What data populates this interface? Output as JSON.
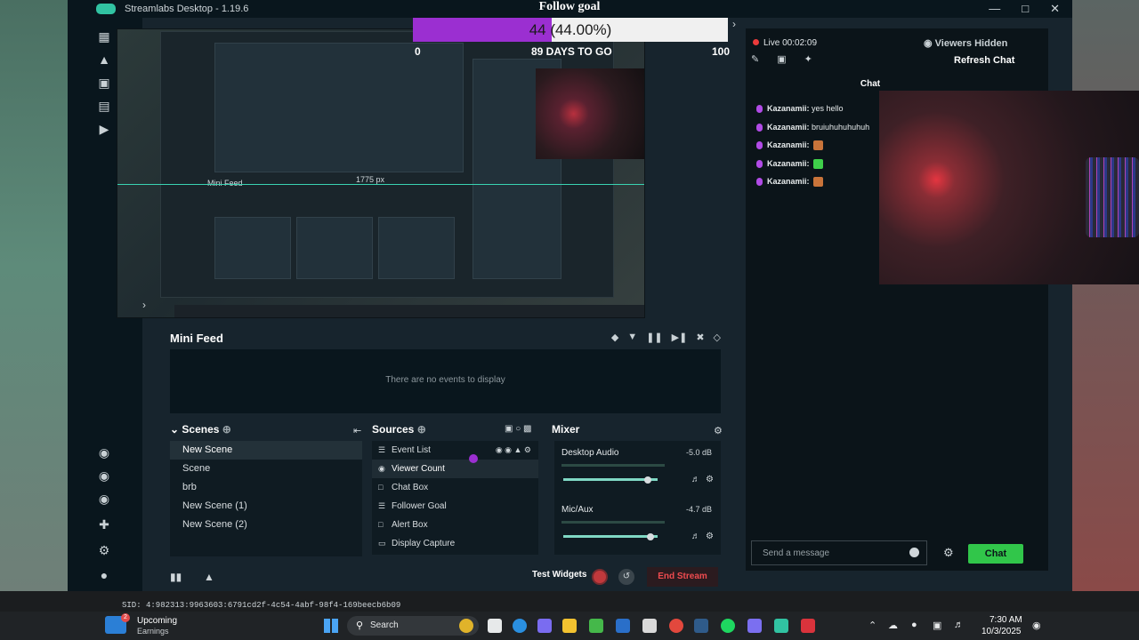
{
  "window": {
    "title": "Streamlabs Desktop - 1.19.6"
  },
  "follow_goal": {
    "title": "Follow goal",
    "progress_text": "44 (44.00%)",
    "progress": 0.44,
    "min": "0",
    "to_go": "89 DAYS TO GO",
    "max": "100",
    "fill_color": "#9b2fd1"
  },
  "preview": {
    "guide_label": "1775 px",
    "mini_feed_label": "Mini Feed"
  },
  "mini_feed": {
    "title": "Mini Feed",
    "empty": "There are no events to display"
  },
  "scenes": {
    "title": "Scenes",
    "items": [
      "New Scene",
      "Scene",
      "brb",
      "New Scene (1)",
      "New Scene (2)"
    ],
    "active": "New Scene"
  },
  "sources": {
    "title": "Sources",
    "items": [
      "Event List",
      "Viewer Count",
      "Chat Box",
      "Follower Goal",
      "Alert Box",
      "Display Capture"
    ],
    "icons": [
      "list-icon",
      "eye-icon",
      "chat-icon",
      "list-icon",
      "alert-icon",
      "display-icon"
    ]
  },
  "mixer": {
    "title": "Mixer",
    "channels": [
      {
        "name": "Desktop Audio",
        "db": "-5.0 dB",
        "level": 0.9
      },
      {
        "name": "Mic/Aux",
        "db": "-4.7 dB",
        "level": 0.92
      }
    ]
  },
  "footer": {
    "test_widgets": "Test Widgets",
    "end_stream": "End Stream"
  },
  "chat_panel": {
    "live_time": "Live 00:02:09",
    "viewers": "Viewers Hidden",
    "refresh": "Refresh Chat",
    "title": "Chat",
    "messages": [
      {
        "user": "Kazanamii:",
        "text": "yes hello",
        "emote": ""
      },
      {
        "user": "Kazanamii:",
        "text": "bruiuhuhuhuhuh",
        "emote": ""
      },
      {
        "user": "Kazanamii:",
        "text": "",
        "emote": "#c9743a"
      },
      {
        "user": "Kazanamii:",
        "text": "",
        "emote": "#3fcf4a"
      },
      {
        "user": "Kazanamii:",
        "text": "",
        "emote": "#c9743a"
      }
    ],
    "placeholder": "Send a message",
    "send_label": "Chat"
  },
  "sid": "SID: 4:982313:9963603:6791cd2f-4c54-4abf-98f4-169beecb6b09",
  "taskbar": {
    "weather_title": "Upcoming",
    "weather_sub": "Earnings",
    "badge": "2",
    "search": "Search",
    "time": "7:30 AM",
    "date": "10/3/2025"
  },
  "colors": {
    "accent": "#31c3a2",
    "live": "#ec3b3b",
    "chat_button": "#31c64a",
    "end_stream": "#ef4b4f"
  }
}
